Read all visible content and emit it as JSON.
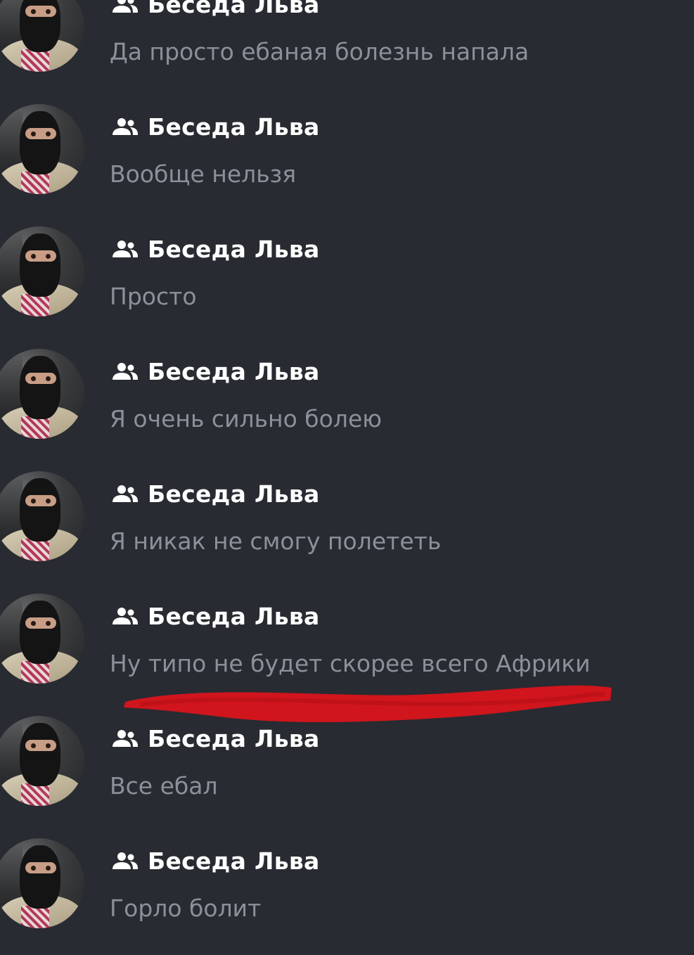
{
  "conversations": [
    {
      "name": "Беседа Льва",
      "preview": "Да просто ебаная болезнь напала",
      "avatar_icon": "user-avatar-balaclava",
      "type_icon": "group-icon"
    },
    {
      "name": "Беседа Льва",
      "preview": "Вообще нельзя",
      "avatar_icon": "user-avatar-balaclava",
      "type_icon": "group-icon"
    },
    {
      "name": "Беседа Льва",
      "preview": "Просто",
      "avatar_icon": "user-avatar-balaclava",
      "type_icon": "group-icon"
    },
    {
      "name": "Беседа Льва",
      "preview": "Я очень сильно болею",
      "avatar_icon": "user-avatar-balaclava",
      "type_icon": "group-icon"
    },
    {
      "name": "Беседа Льва",
      "preview": "Я никак не смогу полететь",
      "avatar_icon": "user-avatar-balaclava",
      "type_icon": "group-icon"
    },
    {
      "name": "Беседа Льва",
      "preview": "Ну типо не будет скорее всего Африки",
      "avatar_icon": "user-avatar-balaclava",
      "type_icon": "group-icon"
    },
    {
      "name": "Беседа Льва",
      "preview": "Все ебал",
      "avatar_icon": "user-avatar-balaclava",
      "type_icon": "group-icon"
    },
    {
      "name": "Беседа Льва",
      "preview": "Горло болит",
      "avatar_icon": "user-avatar-balaclava",
      "type_icon": "group-icon"
    }
  ],
  "colors": {
    "background": "#282b31",
    "name_text": "#ffffff",
    "preview_text": "#8b919a",
    "annotation_stroke": "#d9141c"
  }
}
